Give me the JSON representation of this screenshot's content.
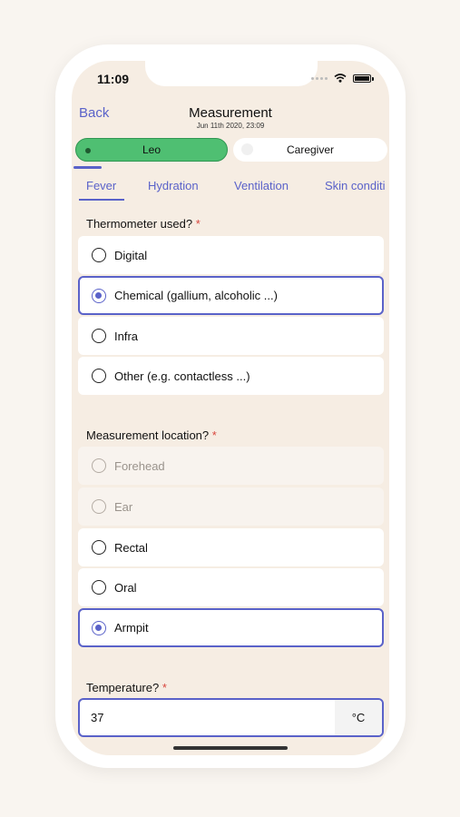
{
  "status": {
    "time": "11:09"
  },
  "nav": {
    "back": "Back",
    "title": "Measurement",
    "subtitle": "Jun 11th 2020, 23:09"
  },
  "segments": {
    "patient": "Leo",
    "caregiver": "Caregiver",
    "active": "Leo"
  },
  "tabs": [
    {
      "label": "Fever",
      "active": true
    },
    {
      "label": "Hydration",
      "active": false
    },
    {
      "label": "Ventilation",
      "active": false
    },
    {
      "label": "Skin conditi",
      "active": false
    }
  ],
  "thermometer": {
    "question": "Thermometer used?",
    "required_mark": "*",
    "options": [
      {
        "label": "Digital",
        "state": "unselected"
      },
      {
        "label": "Chemical (gallium, alcoholic ...)",
        "state": "selected"
      },
      {
        "label": "Infra",
        "state": "unselected"
      },
      {
        "label": "Other (e.g. contactless ...)",
        "state": "unselected"
      }
    ]
  },
  "location": {
    "question": "Measurement location?",
    "required_mark": "*",
    "options": [
      {
        "label": "Forehead",
        "state": "disabled"
      },
      {
        "label": "Ear",
        "state": "disabled"
      },
      {
        "label": "Rectal",
        "state": "unselected"
      },
      {
        "label": "Oral",
        "state": "unselected"
      },
      {
        "label": "Armpit",
        "state": "selected"
      }
    ]
  },
  "temperature": {
    "question": "Temperature?",
    "required_mark": "*",
    "value": "37",
    "unit": "°C"
  },
  "colors": {
    "accent": "#5a62c9",
    "active_segment": "#4fbf72",
    "screen_bg": "#f6ede3",
    "required": "#d8463e"
  }
}
